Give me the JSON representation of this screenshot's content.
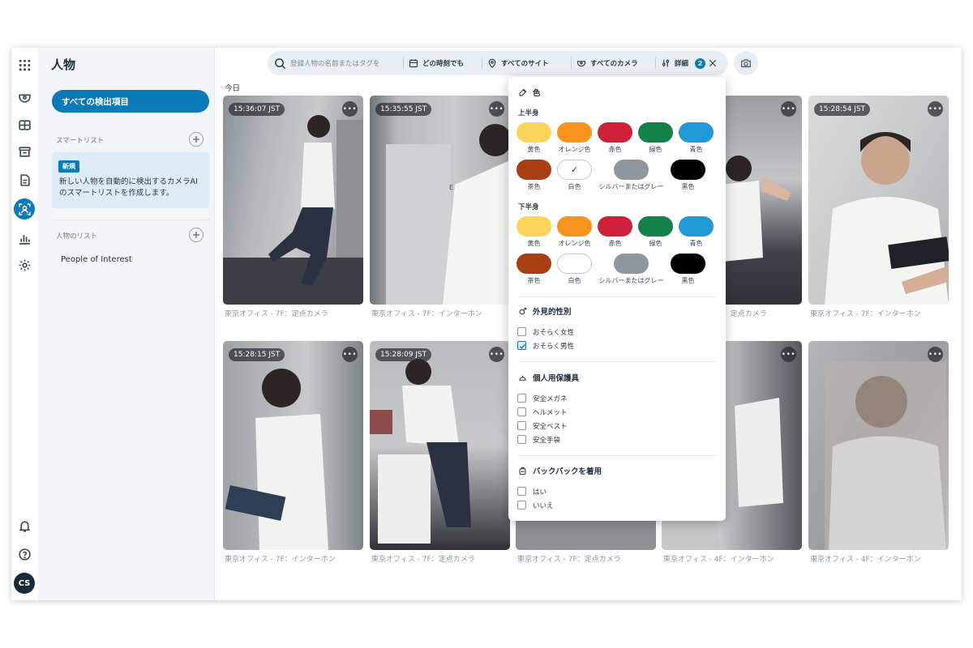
{
  "app": {
    "user_initials": "CS"
  },
  "panel": {
    "title": "人物",
    "all_items_label": "すべての検出項目",
    "smart_list_label": "スマートリスト",
    "promo_badge": "新規",
    "promo_text": "新しい人物を自動的に検出するカメラAIのスマートリストを作成します。",
    "person_list_label": "人物のリスト",
    "person_lists": [
      "People of Interest"
    ]
  },
  "topbar": {
    "search_placeholder": "登録人物の名前またはタグを",
    "time_label": "どの時刻でも",
    "site_label": "すべてのサイト",
    "camera_label": "すべてのカメラ",
    "details_label": "詳細",
    "details_count": "2"
  },
  "today_label": "今日",
  "cards": [
    {
      "time": "15:36:07 JST",
      "caption": "東京オフィス - 7F：定点カメラ"
    },
    {
      "time": "15:35:55 JST",
      "caption": "東京オフィス - 7F：インターホン"
    },
    {
      "time": "",
      "caption": ""
    },
    {
      "time": "",
      "caption": "東京オフィス - 7F：定点カメラ"
    },
    {
      "time": "15:28:54 JST",
      "caption": "東京オフィス - 7F：インターホン"
    },
    {
      "time": "15:28:15 JST",
      "caption": "東京オフィス - 7F：インターホン"
    },
    {
      "time": "15:28:09 JST",
      "caption": "東京オフィス - 7F：定点カメラ"
    },
    {
      "time": "",
      "caption": "東京オフィス - 7F：定点カメラ"
    },
    {
      "time": "",
      "caption": "東京オフィス - 4F：インターホン"
    },
    {
      "time": "",
      "caption": "東京オフィス - 4F：インターホン"
    }
  ],
  "filters": {
    "color_title": "色",
    "upper_label": "上半身",
    "lower_label": "下半身",
    "colors": [
      {
        "label": "黄色",
        "hex": "#fdd45a"
      },
      {
        "label": "オレンジ色",
        "hex": "#f7941d"
      },
      {
        "label": "赤色",
        "hex": "#d0213a"
      },
      {
        "label": "緑色",
        "hex": "#14804a"
      },
      {
        "label": "青色",
        "hex": "#1f9ad6"
      },
      {
        "label": "茶色",
        "hex": "#a83f12"
      },
      {
        "label": "白色",
        "hex": "#ffffff"
      },
      {
        "label": "シルバーまたはグレー",
        "hex": "#8e979f"
      },
      {
        "label": "黒色",
        "hex": "#000000"
      }
    ],
    "upper_selected": "白色",
    "gender_title": "外見的性別",
    "gender_options": [
      {
        "label": "おそらく女性",
        "checked": false
      },
      {
        "label": "おそらく男性",
        "checked": true
      }
    ],
    "ppe_title": "個人用保護具",
    "ppe_options": [
      {
        "label": "安全メガネ",
        "checked": false
      },
      {
        "label": "ヘルメット",
        "checked": false
      },
      {
        "label": "安全ベスト",
        "checked": false
      },
      {
        "label": "安全手袋",
        "checked": false
      }
    ],
    "backpack_title": "バックパックを着用",
    "backpack_options": [
      {
        "label": "はい",
        "checked": false
      },
      {
        "label": "いいえ",
        "checked": false
      }
    ]
  }
}
